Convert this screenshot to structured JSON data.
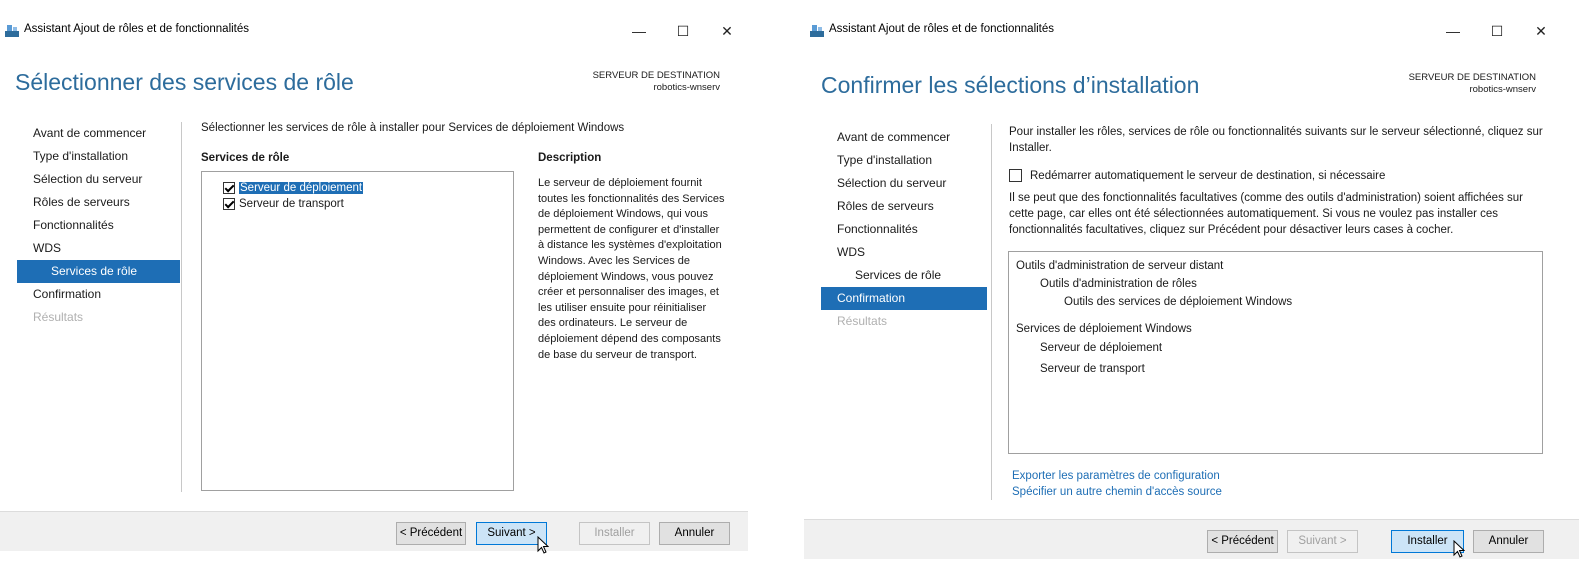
{
  "left": {
    "title": "Assistant Ajout de rôles et de fonctionnalités",
    "heading": "Sélectionner des services de rôle",
    "dest_label": "SERVEUR DE DESTINATION",
    "dest_server": "robotics-wnserv",
    "nav": [
      "Avant de commencer",
      "Type d'installation",
      "Sélection du serveur",
      "Rôles de serveurs",
      "Fonctionnalités",
      "WDS",
      "Services de rôle",
      "Confirmation",
      "Résultats"
    ],
    "intro": "Sélectionner les services de rôle à installer pour Services de déploiement Windows",
    "services_header": "Services de rôle",
    "services": [
      {
        "label": "Serveur de déploiement",
        "checked": true,
        "selected": true
      },
      {
        "label": "Serveur de transport",
        "checked": true,
        "selected": false
      }
    ],
    "description_header": "Description",
    "description": "Le serveur de déploiement fournit toutes les fonctionnalités des Services de déploiement Windows, qui vous permettent de configurer et d'installer à distance les systèmes d'exploitation Windows. Avec les Services de déploiement Windows, vous pouvez créer et personnaliser des images, et les utiliser ensuite pour réinitialiser des ordinateurs. Le serveur de déploiement dépend des composants de base du serveur de transport.",
    "buttons": {
      "prev": "< Précédent",
      "next": "Suivant >",
      "install": "Installer",
      "cancel": "Annuler"
    }
  },
  "right": {
    "title": "Assistant Ajout de rôles et de fonctionnalités",
    "heading": "Confirmer les sélections d’installation",
    "dest_label": "SERVEUR DE DESTINATION",
    "dest_server": "robotics-wnserv",
    "nav": [
      "Avant de commencer",
      "Type d'installation",
      "Sélection du serveur",
      "Rôles de serveurs",
      "Fonctionnalités",
      "WDS",
      "Services de rôle",
      "Confirmation",
      "Résultats"
    ],
    "intro": "Pour installer les rôles, services de rôle ou fonctionnalités suivants sur le serveur sélectionné, cliquez sur Installer.",
    "restart_label": "Redémarrer automatiquement le serveur de destination, si nécessaire",
    "note": "Il se peut que des fonctionnalités facultatives (comme des outils d'administration) soient affichées sur cette page, car elles ont été sélectionnées automatiquement. Si vous ne voulez pas installer ces fonctionnalités facultatives, cliquez sur Précédent pour désactiver leurs cases à cocher.",
    "tree": [
      {
        "text": "Outils d'administration de serveur distant",
        "level": 0
      },
      {
        "text": "Outils d'administration de rôles",
        "level": 1
      },
      {
        "text": "Outils des services de déploiement Windows",
        "level": 2
      },
      {
        "text": "Services de déploiement Windows",
        "level": 0
      },
      {
        "text": "Serveur de déploiement",
        "level": 1
      },
      {
        "text": "Serveur de transport",
        "level": 1
      }
    ],
    "links": [
      "Exporter les paramètres de configuration",
      "Spécifier un autre chemin d'accès source"
    ],
    "buttons": {
      "prev": "< Précédent",
      "next": "Suivant >",
      "install": "Installer",
      "cancel": "Annuler"
    }
  },
  "window_controls": {
    "minimize": "—",
    "maximize": "☐",
    "close": "✕"
  }
}
